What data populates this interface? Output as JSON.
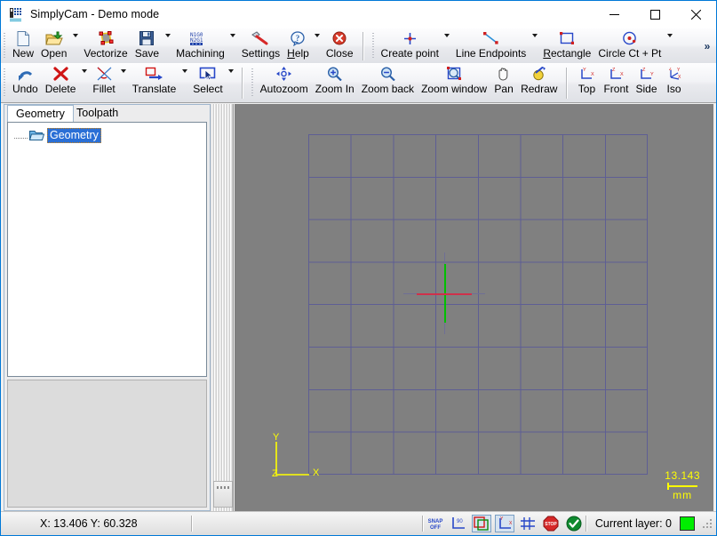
{
  "window": {
    "title": "SimplyCam - Demo mode",
    "app_icon": "simplycam-logo-icon",
    "minimize_label": "—",
    "maximize_label": "□",
    "close_label": "✕"
  },
  "toolbar_main": {
    "overflow_label": "»",
    "items": [
      {
        "name": "new",
        "label": "New",
        "icon": "new-document-icon",
        "dropdown": false
      },
      {
        "name": "open",
        "label": "Open",
        "icon": "open-folder-icon",
        "dropdown": true
      },
      {
        "name": "vectorize",
        "label": "Vectorize",
        "icon": "vectorize-icon",
        "dropdown": false
      },
      {
        "name": "save",
        "label": "Save",
        "icon": "floppy-disk-icon",
        "dropdown": true
      },
      {
        "name": "machining",
        "label": "Machining",
        "icon": "nc-code-icon",
        "dropdown": true
      },
      {
        "name": "settings",
        "label": "Settings",
        "icon": "hammer-icon",
        "dropdown": false
      },
      {
        "name": "help",
        "label": "Help",
        "icon": "help-balloon-icon",
        "dropdown": true,
        "accel": "H"
      },
      {
        "name": "close",
        "label": "Close",
        "icon": "close-circle-icon",
        "dropdown": false
      },
      {
        "name": "create-point",
        "label": "Create point",
        "icon": "create-point-icon",
        "dropdown": true
      },
      {
        "name": "line-endpoints",
        "label": "Line Endpoints",
        "icon": "line-endpoints-icon",
        "dropdown": true
      },
      {
        "name": "rectangle",
        "label": "Rectangle",
        "icon": "rectangle-icon",
        "dropdown": false,
        "accel": "R"
      },
      {
        "name": "circle-ct-pt",
        "label": "Circle Ct + Pt",
        "icon": "circle-center-point-icon",
        "dropdown": true
      }
    ]
  },
  "toolbar_edit": {
    "items": [
      {
        "name": "undo",
        "label": "Undo",
        "icon": "undo-arrow-icon",
        "dropdown": false
      },
      {
        "name": "delete",
        "label": "Delete",
        "icon": "delete-x-icon",
        "dropdown": true
      },
      {
        "name": "fillet",
        "label": "Fillet",
        "icon": "fillet-icon",
        "dropdown": true
      },
      {
        "name": "translate",
        "label": "Translate",
        "icon": "translate-icon",
        "dropdown": true
      },
      {
        "name": "select",
        "label": "Select",
        "icon": "select-arrow-icon",
        "dropdown": true
      }
    ]
  },
  "toolbar_view": {
    "items": [
      {
        "name": "autozoom",
        "label": "Autozoom",
        "icon": "autozoom-icon"
      },
      {
        "name": "zoom-in",
        "label": "Zoom In",
        "icon": "zoom-in-icon"
      },
      {
        "name": "zoom-back",
        "label": "Zoom back",
        "icon": "zoom-out-icon"
      },
      {
        "name": "zoom-window",
        "label": "Zoom window",
        "icon": "zoom-window-icon"
      },
      {
        "name": "pan",
        "label": "Pan",
        "icon": "hand-pan-icon"
      },
      {
        "name": "redraw",
        "label": "Redraw",
        "icon": "redraw-icon"
      }
    ],
    "views": [
      {
        "name": "top",
        "label": "Top",
        "icon": "view-top-icon"
      },
      {
        "name": "front",
        "label": "Front",
        "icon": "view-front-icon"
      },
      {
        "name": "side",
        "label": "Side",
        "icon": "view-side-icon"
      },
      {
        "name": "iso",
        "label": "Iso",
        "icon": "view-iso-icon"
      }
    ]
  },
  "left_panel": {
    "tabs": [
      {
        "name": "geometry",
        "label": "Geometry",
        "active": true
      },
      {
        "name": "toolpath",
        "label": "Toolpath",
        "active": false
      }
    ],
    "tree": {
      "root_label": "Geometry",
      "root_icon": "folder-open-icon",
      "selected": true
    }
  },
  "canvas": {
    "axis": {
      "y_label": "Y",
      "x_label": "X",
      "z_label": "Z"
    },
    "scale": {
      "value": "13.143",
      "unit": "mm"
    },
    "grid": {
      "columns": 8,
      "rows": 8
    },
    "colors": {
      "background": "#808080",
      "grid_line": "#5e5e94",
      "axis": "#ffff00",
      "crosshair_vertical": "#00c000",
      "crosshair_horizontal": "#d0304a"
    }
  },
  "status_bar": {
    "coordinates": "X: 13.406 Y: 60.328",
    "icons": [
      {
        "name": "snap-off-toggle",
        "label": "SNAP OFF",
        "pressed": false
      },
      {
        "name": "ortho-90-toggle",
        "label": "90",
        "pressed": false
      },
      {
        "name": "group-select-toggle",
        "label": "group",
        "pressed": true
      },
      {
        "name": "origin-toggle",
        "label": "origin",
        "pressed": true
      },
      {
        "name": "grid-toggle",
        "label": "grid",
        "pressed": false
      },
      {
        "name": "stop-button",
        "label": "STOP",
        "pressed": false
      },
      {
        "name": "confirm-button",
        "label": "OK",
        "pressed": false
      }
    ],
    "layer_label": "Current layer: 0",
    "layer_color": "#00ee00"
  }
}
